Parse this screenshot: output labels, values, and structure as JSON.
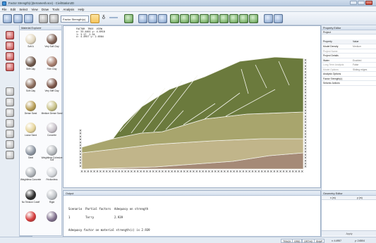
{
  "window": {
    "title": "Factor Strength(c)(terramesh.sce) - CivilStation2D",
    "close_icon": "close-icon",
    "min_icon": "minimize-icon",
    "max_icon": "maximize-icon"
  },
  "menu": [
    "File",
    "Edit",
    "Select",
    "View",
    "Draw",
    "Tools",
    "Analysis",
    "Help"
  ],
  "toolbar": {
    "factor_dropdown": "Factor Strength(c)",
    "delta_symbol": "δ"
  },
  "material_explorer": {
    "title": "Material Explorer",
    "items": [
      {
        "label": "Soft A",
        "color": "#e2d7bf"
      },
      {
        "label": "Very Soft Clay",
        "color": "#7d5f52"
      },
      {
        "label": "Stiff Clay",
        "color": "#6d5548"
      },
      {
        "label": "Firm Clay",
        "color": "#a67c6c"
      },
      {
        "label": "Soft Clay",
        "color": "#8a6b5a"
      },
      {
        "label": "Very Stiff Clay",
        "color": "#7a5447"
      },
      {
        "label": "Dense Sand",
        "color": "#b79d55"
      },
      {
        "label": "Medium Dense Sand",
        "color": "#c7c086"
      },
      {
        "label": "Loose Sand",
        "color": "#e6d49a"
      },
      {
        "label": "Concrete",
        "color": "#c6c0c8"
      },
      {
        "label": "Steel",
        "color": "#8d96a2"
      },
      {
        "label": "Weightless Cohesive Soil",
        "color": "#b4b8bc"
      },
      {
        "label": "Weightless Concrete",
        "color": "#aeb3b8"
      },
      {
        "label": "Frictionless",
        "color": "#d3d6da"
      },
      {
        "label": "No Tension Cutoff",
        "color": "#2b2b2b"
      },
      {
        "label": "Rigid",
        "color": "#bfc3c7"
      },
      {
        "label": "",
        "color": "#d43a3a"
      },
      {
        "label": "",
        "color": "#7f6f8c"
      }
    ],
    "tabs": [
      "Material",
      "Model Regions"
    ]
  },
  "model_view": {
    "coord_lines": [
      "FACTOR  TREE  VIEW",
      "x: 33.4401 y: 4.8910",
      "1: 3.17  2.54",
      "x: 4.4957 y: 2.6504"
    ],
    "colors": {
      "upper_slope": "#6b7a3d",
      "middle_layer": "#a8a56d",
      "lower_layer": "#c1b58a",
      "base_layer": "#a58a77",
      "fixity": "#333333"
    }
  },
  "output": {
    "title": "Output",
    "lines": [
      "Scenario  Partial factors  Adequacy on strength",
      "",
      "1         Terry            2.939",
      "",
      "",
      "Adequacy factor on material strength(c) is 2.939"
    ],
    "tabs": [
      "Output",
      "Boundary Explorer",
      "Solid Explorer"
    ]
  },
  "property_editor": {
    "title": "Property Editor",
    "section": "Project",
    "columns": [
      "Property",
      "Value"
    ],
    "rows": [
      {
        "k": "Model Density",
        "v": "Medium",
        "dim": false
      },
      {
        "k": "Project Name",
        "v": "",
        "dim": true
      },
      {
        "k": "Project Details",
        "v": "",
        "dim": false
      },
      {
        "k": "Water",
        "v": "Enabled",
        "dim": false
      },
      {
        "k": "Long Term Analysis",
        "v": "False",
        "dim": true
      },
      {
        "k": "Model Options",
        "v": "Sliding edges",
        "dim": true
      },
      {
        "k": "Analysis Options",
        "v": "",
        "dim": false
      },
      {
        "k": "Factor Strength(c)",
        "v": "",
        "dim": false
      },
      {
        "k": "Seismic Actions",
        "v": "",
        "dim": false
      }
    ]
  },
  "geometry_editor": {
    "title": "Geometry Editor",
    "columns": [
      "x (m)",
      "y (m)"
    ],
    "apply": "Apply"
  },
  "statusbar": {
    "items": [
      "TRACK",
      "GRID",
      "ORTHO",
      "SNAP"
    ],
    "x": "x: 4.4957",
    "y": "y: 2.6504"
  }
}
